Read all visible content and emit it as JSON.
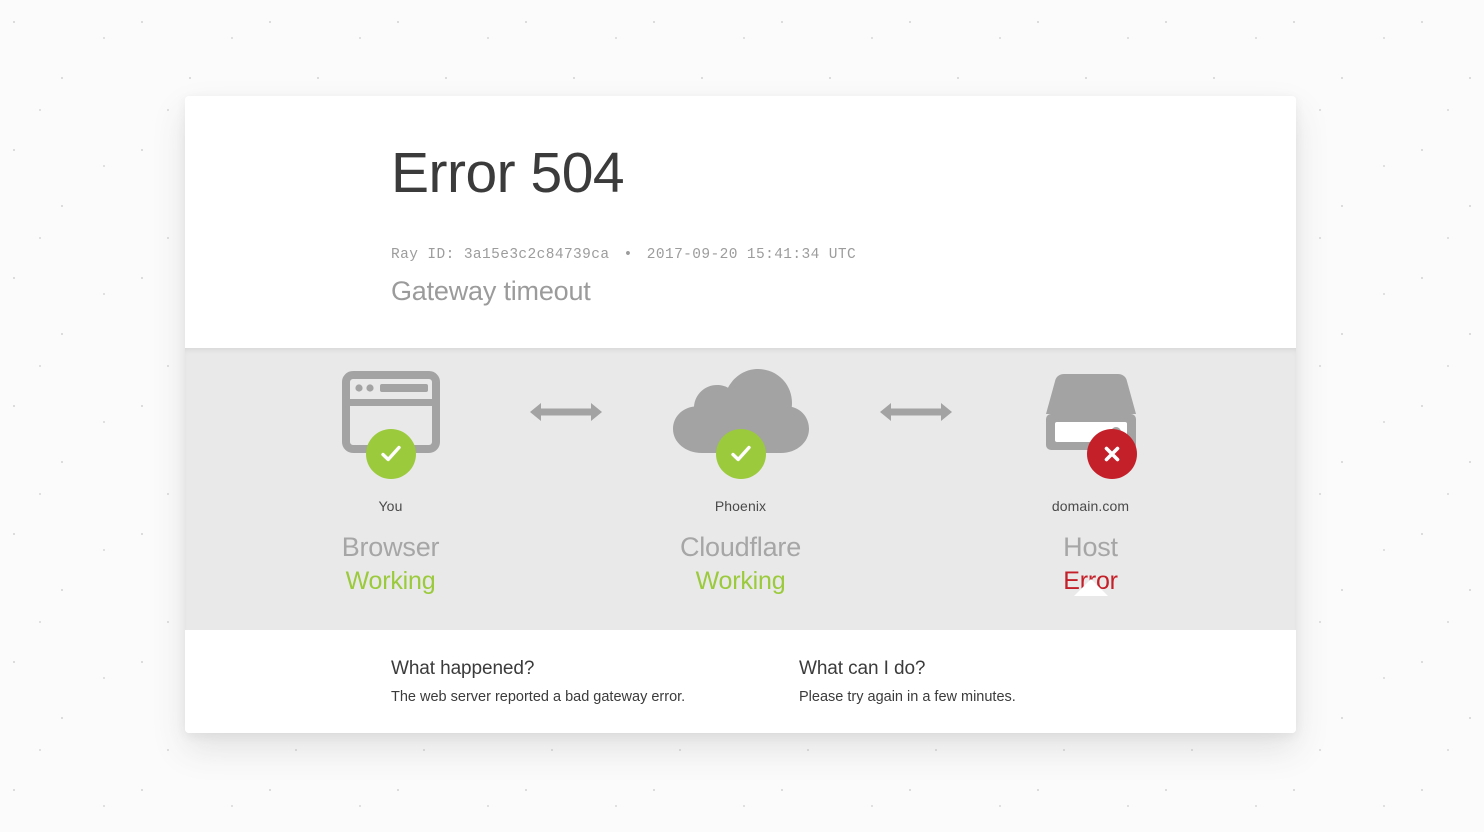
{
  "page": {
    "error_title": "Error 504",
    "ray_label": "Ray ID:",
    "ray_id": "3a15e3c2c84739ca",
    "separator": "•",
    "timestamp": "2017-09-20 15:41:34 UTC",
    "subtitle": "Gateway timeout"
  },
  "status": {
    "columns": [
      {
        "host": "You",
        "layer": "Browser",
        "state": "Working",
        "state_kind": "working",
        "icon": "browser-window-icon",
        "badge": "check-badge-icon"
      },
      {
        "host": "Phoenix",
        "layer": "Cloudflare",
        "state": "Working",
        "state_kind": "working",
        "icon": "cloud-icon",
        "badge": "check-badge-icon"
      },
      {
        "host": "domain.com",
        "layer": "Host",
        "state": "Error",
        "state_kind": "error",
        "icon": "server-icon",
        "badge": "cross-badge-icon"
      }
    ],
    "connectors": [
      "double-arrow-icon",
      "double-arrow-icon"
    ]
  },
  "footer": {
    "items": [
      {
        "question": "What happened?",
        "answer": "The web server reported a bad gateway error."
      },
      {
        "question": "What can I do?",
        "answer": "Please try again in a few minutes."
      }
    ]
  },
  "colors": {
    "working": "#9bca3c",
    "error": "#c4202a",
    "icon_gray": "#a3a3a3",
    "band": "#e9e9e9",
    "title": "#3b3b3b"
  }
}
